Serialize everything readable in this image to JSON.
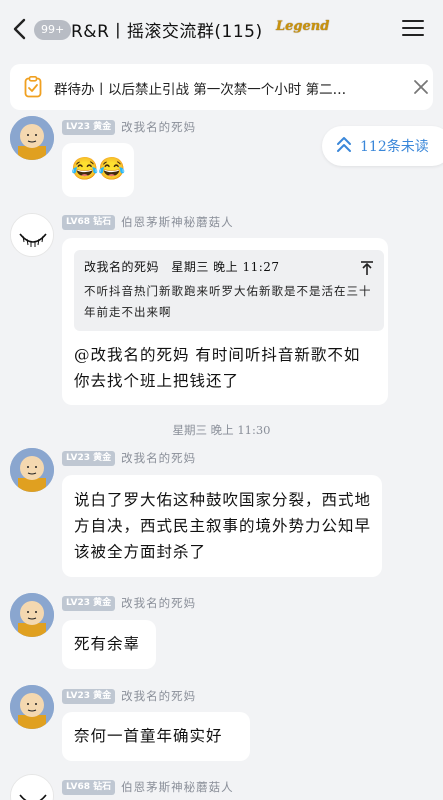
{
  "header": {
    "unread_count": "99+",
    "title": "R&R丨摇滚交流群(115)",
    "badge_text": "Legend"
  },
  "notice": {
    "text": "群待办丨以后禁止引战 第一次禁一个小时 第二…"
  },
  "unread_jump": {
    "label": "112条未读"
  },
  "messages": [
    {
      "level": "LV23",
      "rank": "黄金",
      "nickname": "改我名的死妈",
      "emoji": "😂😂"
    },
    {
      "level": "LV68",
      "rank": "钻石",
      "nickname": "伯恩茅斯神秘蘑菇人",
      "quote_author": "改我名的死妈",
      "quote_time": "星期三 晚上 11:27",
      "quote_text": "不听抖音热门新歌跑来听罗大佑新歌是不是活在三十年前走不出来啊",
      "text": "@改我名的死妈 有时间听抖音新歌不如你去找个班上把钱还了"
    },
    {
      "level": "LV23",
      "rank": "黄金",
      "nickname": "改我名的死妈",
      "text": "说白了罗大佑这种鼓吹国家分裂，西式地方自决，西式民主叙事的境外势力公知早该被全方面封杀了"
    },
    {
      "level": "LV23",
      "rank": "黄金",
      "nickname": "改我名的死妈",
      "text": "死有余辜"
    },
    {
      "level": "LV23",
      "rank": "黄金",
      "nickname": "改我名的死妈",
      "text": "奈何一首童年确实好"
    },
    {
      "level": "LV68",
      "rank": "钻石",
      "nickname": "伯恩茅斯神秘蘑菇人"
    }
  ],
  "timestamp": "星期三 晚上 11:30",
  "colors": {
    "background": "#f2f3f5",
    "bubble": "#ffffff",
    "accent_blue": "#3a87d9",
    "meta_gray": "#8a8f99"
  }
}
